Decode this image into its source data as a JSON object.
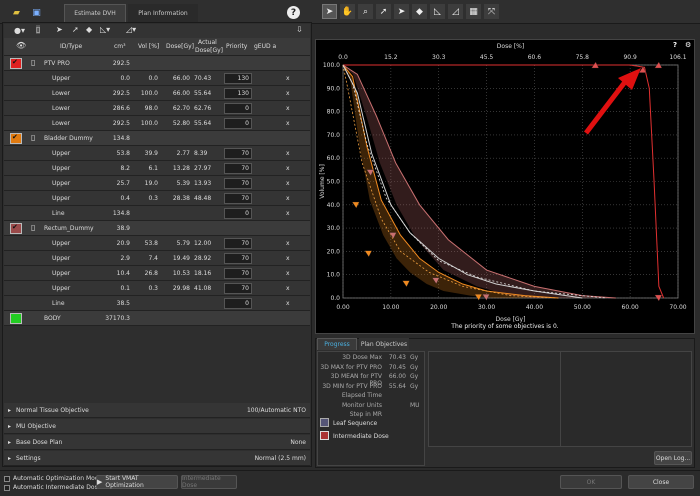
{
  "left_tabs": {
    "estimate_dvh": "Estimate DVH",
    "plan_information": "Plan Information"
  },
  "help_icon": "?",
  "columns": {
    "id_type": "ID/Type",
    "cm3": "cm³",
    "vol": "Vol [%]",
    "dose": "Dose[Gy]",
    "actual_dose_l1": "Actual",
    "actual_dose_l2": "Dose[Gy]",
    "priority": "Priority",
    "geud": "gEUD a"
  },
  "structures": [
    {
      "name": "PTV PRO",
      "cm3": "292.5",
      "color": "#e02020",
      "rows": [
        {
          "type": "Upper",
          "cm3": "0.0",
          "vol": "0.0",
          "dose": "66.00",
          "actual": "70.43",
          "priority": "130",
          "x": "x"
        },
        {
          "type": "Lower",
          "cm3": "292.5",
          "vol": "100.0",
          "dose": "66.00",
          "actual": "55.64",
          "priority": "130",
          "x": "x"
        },
        {
          "type": "Lower",
          "cm3": "286.6",
          "vol": "98.0",
          "dose": "62.70",
          "actual": "62.76",
          "priority": "0",
          "x": "x"
        },
        {
          "type": "Lower",
          "cm3": "292.5",
          "vol": "100.0",
          "dose": "52.80",
          "actual": "55.64",
          "priority": "0",
          "x": "x"
        }
      ]
    },
    {
      "name": "Bladder Dummy",
      "cm3": "134.8",
      "color": "#e07a10",
      "rows": [
        {
          "type": "Upper",
          "cm3": "53.8",
          "vol": "39.9",
          "dose": "2.77",
          "actual": "8.39",
          "priority": "70",
          "x": "x"
        },
        {
          "type": "Upper",
          "cm3": "8.2",
          "vol": "6.1",
          "dose": "13.28",
          "actual": "27.97",
          "priority": "70",
          "x": "x"
        },
        {
          "type": "Upper",
          "cm3": "25.7",
          "vol": "19.0",
          "dose": "5.39",
          "actual": "13.93",
          "priority": "70",
          "x": "x"
        },
        {
          "type": "Upper",
          "cm3": "0.4",
          "vol": "0.3",
          "dose": "28.38",
          "actual": "48.48",
          "priority": "70",
          "x": "x"
        },
        {
          "type": "Line",
          "cm3": "134.8",
          "vol": "",
          "dose": "",
          "actual": "",
          "priority": "0",
          "x": "x"
        }
      ]
    },
    {
      "name": "Rectum_Dummy",
      "cm3": "38.9",
      "color": "#9a4a4a",
      "rows": [
        {
          "type": "Upper",
          "cm3": "20.9",
          "vol": "53.8",
          "dose": "5.79",
          "actual": "12.00",
          "priority": "70",
          "x": "x"
        },
        {
          "type": "Upper",
          "cm3": "2.9",
          "vol": "7.4",
          "dose": "19.49",
          "actual": "28.92",
          "priority": "70",
          "x": "x"
        },
        {
          "type": "Upper",
          "cm3": "10.4",
          "vol": "26.8",
          "dose": "10.53",
          "actual": "18.16",
          "priority": "70",
          "x": "x"
        },
        {
          "type": "Upper",
          "cm3": "0.1",
          "vol": "0.3",
          "dose": "29.98",
          "actual": "41.08",
          "priority": "70",
          "x": "x"
        },
        {
          "type": "Line",
          "cm3": "38.5",
          "vol": "",
          "dose": "",
          "actual": "",
          "priority": "0",
          "x": "x"
        }
      ]
    },
    {
      "name": "BODY",
      "cm3": "37170.3",
      "color": "#22cc22",
      "rows": []
    }
  ],
  "sections": [
    {
      "label": "Normal Tissue Objective",
      "value": "100/Automatic NTO"
    },
    {
      "label": "MU Objective",
      "value": ""
    },
    {
      "label": "Base Dose Plan",
      "value": "None"
    },
    {
      "label": "Settings",
      "value": "Normal (2.5 mm)"
    }
  ],
  "bottom": {
    "auto_opt_mode": "Automatic Optimization Mode",
    "auto_intermediate": "Automatic Intermediate Dose",
    "start_vmat": "Start VMAT Optimization",
    "intermediate_dose": "Intermediate Dose",
    "ok": "OK",
    "close": "Close"
  },
  "chart_data": {
    "type": "line",
    "xlabel_top": "Dose [%]",
    "xlabel": "Dose [Gy]",
    "ylabel": "Volume [%]",
    "x_ticks_gy": [
      "0.00",
      "10.00",
      "20.00",
      "30.00",
      "40.00",
      "50.00",
      "60.00",
      "70.00"
    ],
    "x_ticks_pct": [
      "0.0",
      "15.2",
      "30.3",
      "45.5",
      "60.6",
      "75.8",
      "90.9",
      "106.1"
    ],
    "y_ticks": [
      "100.0",
      "90.0",
      "80.0",
      "70.0",
      "60.0",
      "50.0",
      "40.0",
      "30.0",
      "20.0",
      "10.0",
      "0.0"
    ],
    "xlim": [
      0,
      70
    ],
    "ylim": [
      0,
      100
    ],
    "series": [
      {
        "color": "#e03030",
        "x": [
          0,
          52,
          60,
          63,
          64,
          65,
          66,
          67
        ],
        "y": [
          100,
          100,
          100,
          99,
          90,
          50,
          5,
          0
        ]
      },
      {
        "color": "#f08a20",
        "x": [
          0,
          2,
          5,
          8,
          12,
          16,
          20,
          25,
          30,
          38,
          45
        ],
        "y": [
          100,
          95,
          65,
          42,
          27,
          17,
          11,
          6,
          3,
          1,
          0
        ]
      },
      {
        "color": "#d0d0d0",
        "x": [
          0,
          3,
          6,
          10,
          14,
          20,
          26,
          32,
          40,
          50
        ],
        "y": [
          100,
          88,
          62,
          40,
          28,
          17,
          10,
          6,
          3,
          0
        ]
      },
      {
        "color": "#c87070",
        "x": [
          0,
          3,
          7,
          11,
          16,
          22,
          30,
          40,
          50,
          57
        ],
        "y": [
          100,
          96,
          78,
          58,
          40,
          25,
          12,
          5,
          1,
          0
        ]
      }
    ],
    "message": "The priority of some objectives is 0."
  },
  "right_tabs": {
    "progress": "Progress",
    "plan_objectives": "Plan Objectives"
  },
  "progress_info": [
    {
      "label": "3D Dose Max",
      "value": "70.43",
      "unit": "Gy"
    },
    {
      "label": "3D MAX for PTV PRO",
      "value": "70.45",
      "unit": "Gy"
    },
    {
      "label": "3D MEAN for PTV PRO",
      "value": "66.00",
      "unit": "Gy"
    },
    {
      "label": "3D MIN for PTV PRO",
      "value": "55.64",
      "unit": "Gy"
    },
    {
      "label": "Elapsed Time",
      "value": "",
      "unit": ""
    },
    {
      "label": "Monitor Units",
      "value": "",
      "unit": "MU"
    },
    {
      "label": "Step in MR",
      "value": "",
      "unit": ""
    }
  ],
  "leaf_sequence": "Leaf Sequence",
  "intermediate_dose_label": "Intermediate Dose",
  "open_log": "Open Log..."
}
